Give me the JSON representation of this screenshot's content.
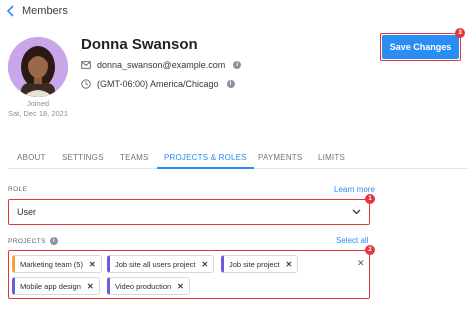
{
  "header": {
    "back_label": "Members"
  },
  "profile": {
    "name": "Donna Swanson",
    "email": "donna_swanson@example.com",
    "timezone": "(GMT-06:00) America/Chicago",
    "joined_label": "Joined",
    "joined_date": "Sat, Dec 18, 2021"
  },
  "actions": {
    "save_label": "Save Changes"
  },
  "tabs": [
    {
      "label": "ABOUT",
      "active": false
    },
    {
      "label": "SETTINGS",
      "active": false
    },
    {
      "label": "TEAMS",
      "active": false
    },
    {
      "label": "PROJECTS & ROLES",
      "active": true
    },
    {
      "label": "PAYMENTS",
      "active": false
    },
    {
      "label": "LIMITS",
      "active": false
    }
  ],
  "role": {
    "label": "ROLE",
    "learn_more": "Learn more",
    "value": "User"
  },
  "projects": {
    "label": "PROJECTS",
    "select_all": "Select all",
    "chips": [
      {
        "label": "Marketing team (5)",
        "color": "#f0a53a"
      },
      {
        "label": "Job site all users project",
        "color": "#6b5be0"
      },
      {
        "label": "Job site project",
        "color": "#6b5be0"
      },
      {
        "label": "Mobile app design",
        "color": "#6b5be0"
      },
      {
        "label": "Video production",
        "color": "#6b5be0"
      }
    ]
  },
  "markers": [
    "1",
    "2",
    "3"
  ],
  "colors": {
    "accent": "#2a8df3",
    "highlight": "#e2363f"
  }
}
